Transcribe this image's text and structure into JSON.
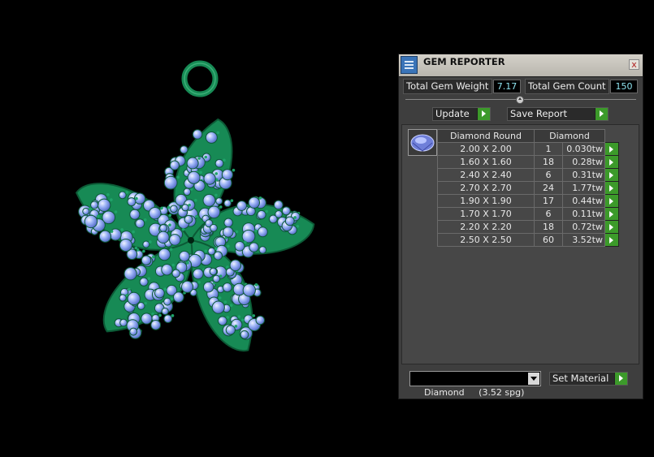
{
  "panel": {
    "title": "GEM REPORTER",
    "close_glyph": "x",
    "total_weight_label": "Total Gem Weight",
    "total_weight_value": "7.17",
    "total_count_label": "Total Gem Count",
    "total_count_value": "150",
    "update_label": "Update",
    "save_report_label": "Save Report",
    "table": {
      "headers": [
        "Diamond Round",
        "Diamond"
      ],
      "rows": [
        {
          "size": "2.00 X 2.00",
          "count": "1",
          "weight": "0.030tw"
        },
        {
          "size": "1.60 X 1.60",
          "count": "18",
          "weight": "0.28tw"
        },
        {
          "size": "2.40 X 2.40",
          "count": "6",
          "weight": "0.31tw"
        },
        {
          "size": "2.70 X 2.70",
          "count": "24",
          "weight": "1.77tw"
        },
        {
          "size": "1.90 X 1.90",
          "count": "17",
          "weight": "0.44tw"
        },
        {
          "size": "1.70 X 1.70",
          "count": "6",
          "weight": "0.11tw"
        },
        {
          "size": "2.20 X 2.20",
          "count": "18",
          "weight": "0.72tw"
        },
        {
          "size": "2.50 X 2.50",
          "count": "60",
          "weight": "3.52tw"
        }
      ]
    },
    "material": {
      "selected": "Diamond     (3.52 spg)",
      "set_label": "Set Material"
    }
  },
  "colors": {
    "metal": "#178a55",
    "gem": "#8aa8f4",
    "panel_bg": "#3e3e3e",
    "accent_green": "#3c9a2a"
  },
  "icons": [
    "gem-reporter-app-icon",
    "close-icon",
    "slider-thumb",
    "diamond-gem-icon",
    "arrow-right-icon",
    "chevron-down-icon"
  ]
}
